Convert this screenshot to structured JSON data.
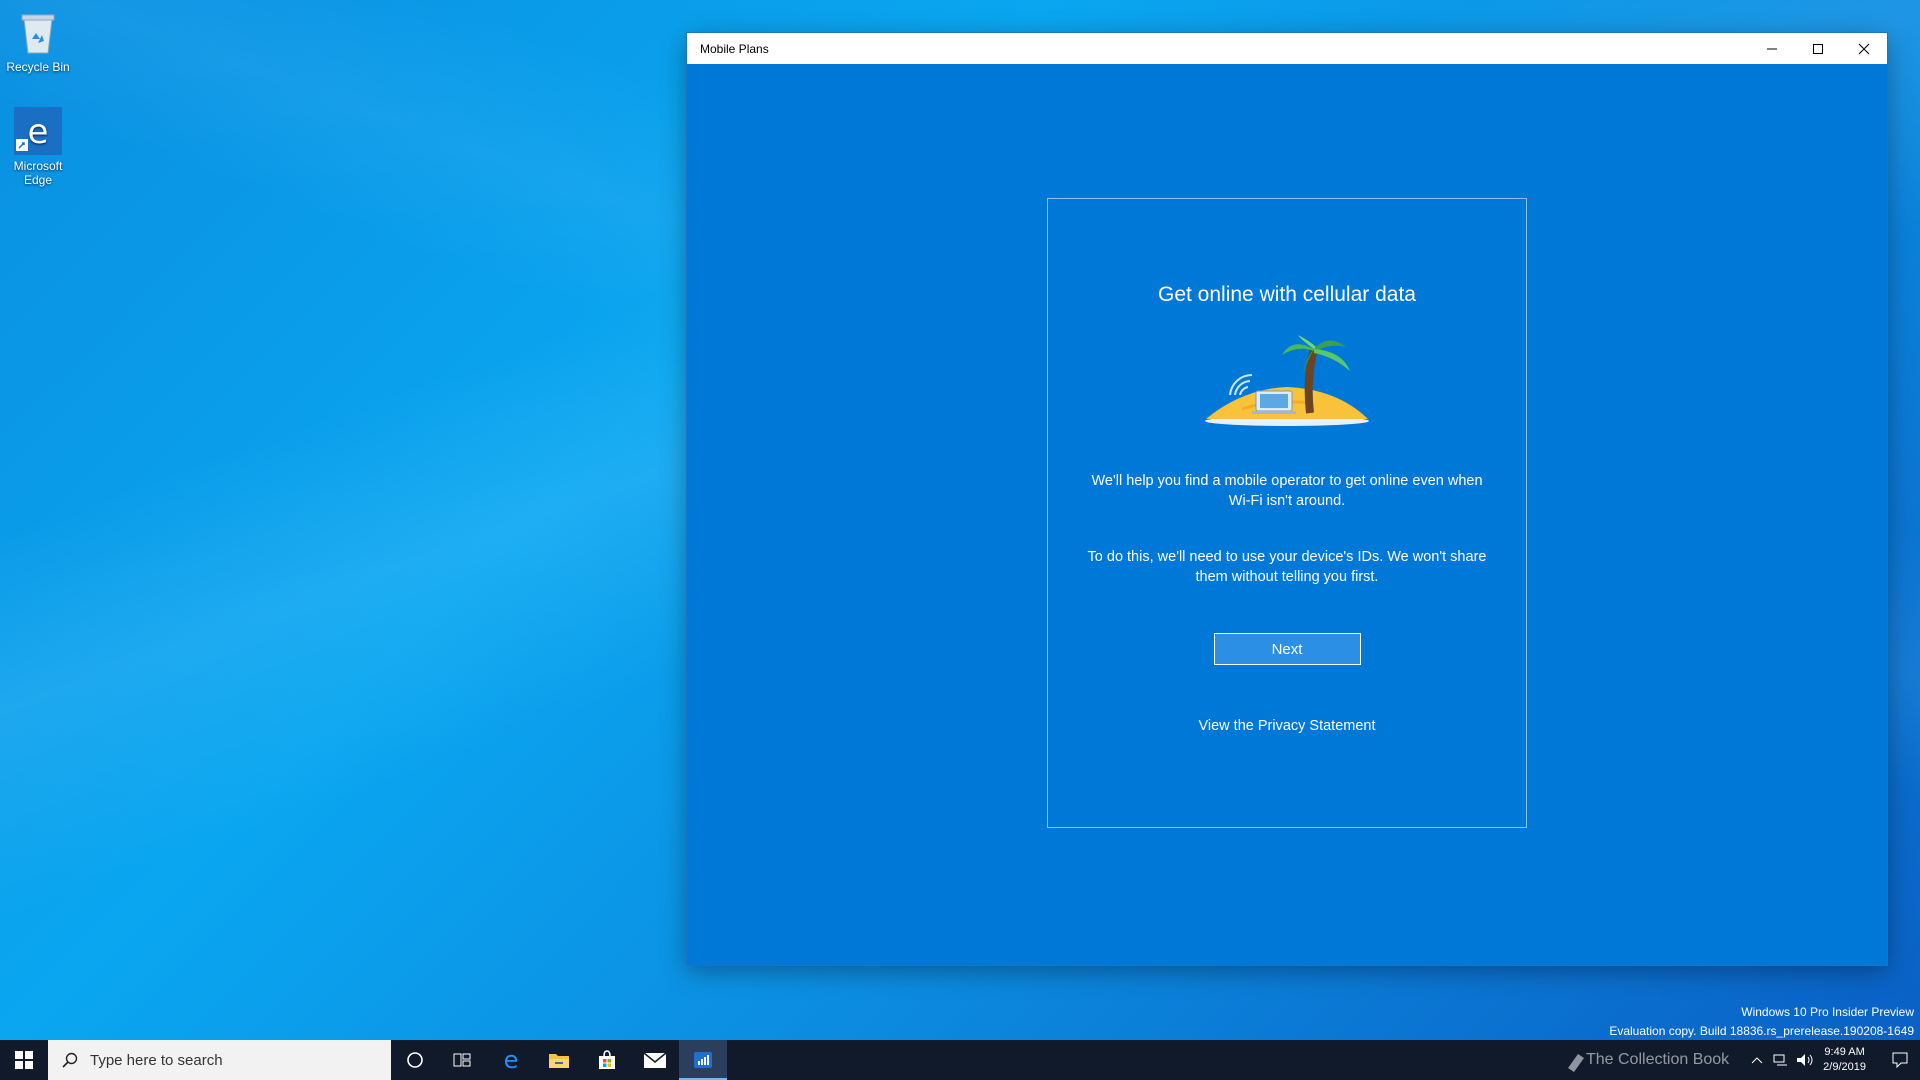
{
  "desktop": {
    "icons": [
      {
        "label": "Recycle Bin"
      },
      {
        "label": "Microsoft Edge"
      }
    ],
    "watermark_line1": "Windows 10 Pro Insider Preview",
    "watermark_line2": "Evaluation copy. Build 18836.rs_prerelease.190208-1649",
    "overlay_text": "The Collection Book"
  },
  "window": {
    "title": "Mobile Plans",
    "heading": "Get online with cellular data",
    "paragraph1": "We'll help you find a mobile operator to get online even when Wi-Fi isn't around.",
    "paragraph2": "To do this, we'll need to use your device's IDs. We won't share them without telling you first.",
    "next_label": "Next",
    "privacy_link": "View the Privacy Statement"
  },
  "taskbar": {
    "search_placeholder": "Type here to search",
    "clock_time": "9:49 AM",
    "clock_date": "2/9/2019"
  },
  "colors": {
    "window_bg": "#0078d7",
    "taskbar_bg": "#101a2a",
    "accent": "#74b8f2"
  }
}
